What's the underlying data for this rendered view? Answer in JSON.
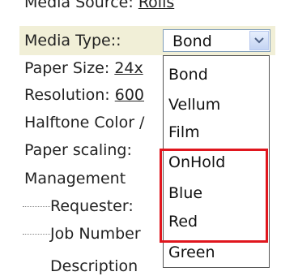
{
  "form": {
    "media_source_label": "Media Source:",
    "media_source_value": "Rolls",
    "media_type_label": "Media Type::",
    "paper_size_label": "Paper Size:",
    "paper_size_value": "24x",
    "resolution_label": "Resolution:",
    "resolution_value": "600",
    "halftone_label": "Halftone Color /",
    "paper_scaling_label": "Paper scaling:",
    "paper_scaling_value": "",
    "management_label": "Management",
    "requester_label": "Requester:",
    "job_number_label": "Job Number",
    "description_label": "Description"
  },
  "media_type_select": {
    "selected": "Bond",
    "options": [
      "Bond",
      "Vellum",
      "Film",
      "OnHold",
      "Blue",
      "Red",
      "Green"
    ]
  },
  "icons": {
    "dropdown_arrow": "chevron-down-icon"
  },
  "colors": {
    "highlight": "#f1efd7",
    "annotation_box": "#e0161e",
    "select_border": "#7f9db9"
  }
}
